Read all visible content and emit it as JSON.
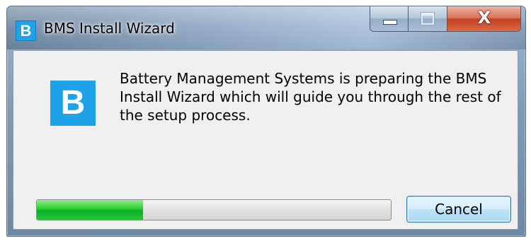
{
  "window": {
    "title": "BMS Install Wizard",
    "app_icon_letter": "B"
  },
  "caption_buttons": {
    "minimize_icon": "minimize-icon",
    "maximize_icon": "maximize-icon",
    "close_icon": "close-icon",
    "close_glyph": "X"
  },
  "main": {
    "logo_letter": "B",
    "message": "Battery Management Systems is preparing the BMS Install Wizard which will guide you through the rest of the setup process.",
    "progress_fraction": 0.3,
    "cancel_label": "Cancel"
  },
  "colors": {
    "brand": "#1ea3e8",
    "progress_green": "#06b025",
    "close_red": "#c44120"
  }
}
